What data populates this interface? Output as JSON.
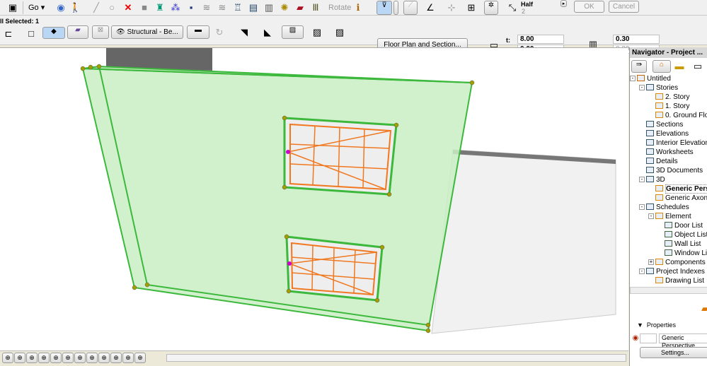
{
  "toolbar1": {
    "go_label": "Go",
    "rotate_label": "Rotate",
    "half_label": "Half",
    "half_value": "2",
    "ok_label": "OK",
    "cancel_label": "Cancel",
    "icons": [
      "window-icon",
      "navigator-orbit-icon",
      "walk-icon",
      "line-icon",
      "circle-icon",
      "delete-icon",
      "paint-icon",
      "brush-icon",
      "magic-icon",
      "save-icon",
      "undo-icon",
      "redo-icon",
      "building-icon",
      "layers-icon",
      "stack-icon",
      "render-icon",
      "edit-icon",
      "section-icon",
      "info-icon"
    ]
  },
  "toolbar2": {
    "selected_label": "ll Selected: 1",
    "layer_label": "Structural - Be...",
    "floor_plan_button": "Floor Plan and Section...",
    "t_label": "t:",
    "t_value": "8.00",
    "b_label": "b:",
    "b_value": "0.00",
    "thickness_value": "0.30",
    "thickness_value2": "0.30"
  },
  "navigator": {
    "title": "Navigator - Project ...",
    "tree": [
      {
        "label": "Untitled",
        "level": 0,
        "expand": "-"
      },
      {
        "label": "Stories",
        "level": 1,
        "expand": "-"
      },
      {
        "label": "2. Story",
        "level": 2
      },
      {
        "label": "1. Story",
        "level": 2
      },
      {
        "label": "0. Ground Floor",
        "level": 2
      },
      {
        "label": "Sections",
        "level": 1
      },
      {
        "label": "Elevations",
        "level": 1
      },
      {
        "label": "Interior Elevations",
        "level": 1
      },
      {
        "label": "Worksheets",
        "level": 1
      },
      {
        "label": "Details",
        "level": 1
      },
      {
        "label": "3D Documents",
        "level": 1
      },
      {
        "label": "3D",
        "level": 1,
        "expand": "-"
      },
      {
        "label": "Generic Perspective",
        "level": 2,
        "bold": true
      },
      {
        "label": "Generic Axonometry",
        "level": 2
      },
      {
        "label": "Schedules",
        "level": 1,
        "expand": "-"
      },
      {
        "label": "Element",
        "level": 2,
        "expand": "-"
      },
      {
        "label": "Door List",
        "level": 3
      },
      {
        "label": "Object List",
        "level": 3
      },
      {
        "label": "Wall List",
        "level": 3
      },
      {
        "label": "Window List",
        "level": 3
      },
      {
        "label": "Components",
        "level": 2,
        "expand": "+"
      },
      {
        "label": "Project Indexes",
        "level": 1,
        "expand": "-"
      },
      {
        "label": "Drawing List",
        "level": 2
      }
    ],
    "properties_label": "Properties",
    "view_name": "Generic Perspective",
    "settings_button": "Settings..."
  },
  "colors": {
    "wall_fill": "#c9efc3",
    "wall_edge": "#3cb83c",
    "window_frame": "#f07820",
    "hotspot": "#a0a000"
  }
}
